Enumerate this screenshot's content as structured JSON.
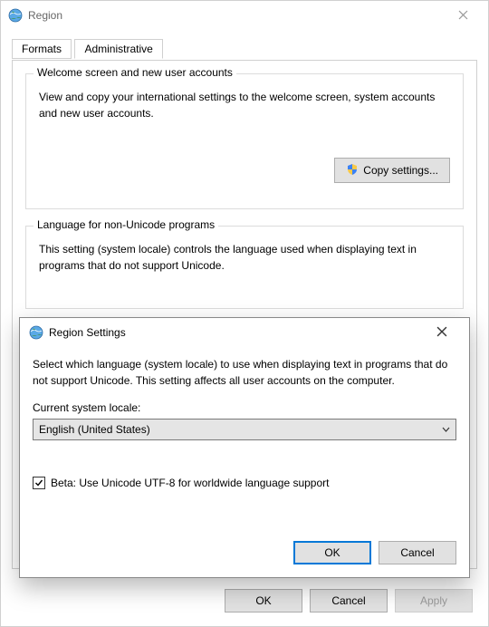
{
  "window": {
    "title": "Region"
  },
  "tabs": {
    "formats": "Formats",
    "administrative": "Administrative"
  },
  "group1": {
    "title": "Welcome screen and new user accounts",
    "text": "View and copy your international settings to the welcome screen, system accounts and new user accounts.",
    "button": "Copy settings..."
  },
  "group2": {
    "title": "Language for non-Unicode programs",
    "text": "This setting (system locale) controls the language used when displaying text in programs that do not support Unicode."
  },
  "buttons": {
    "ok": "OK",
    "cancel": "Cancel",
    "apply": "Apply"
  },
  "dialog": {
    "title": "Region Settings",
    "text": "Select which language (system locale) to use when displaying text in programs that do not support Unicode. This setting affects all user accounts on the computer.",
    "locale_label": "Current system locale:",
    "locale_value": "English (United States)",
    "checkbox_label": "Beta: Use Unicode UTF-8 for worldwide language support",
    "checkbox_checked": true,
    "ok": "OK",
    "cancel": "Cancel"
  }
}
